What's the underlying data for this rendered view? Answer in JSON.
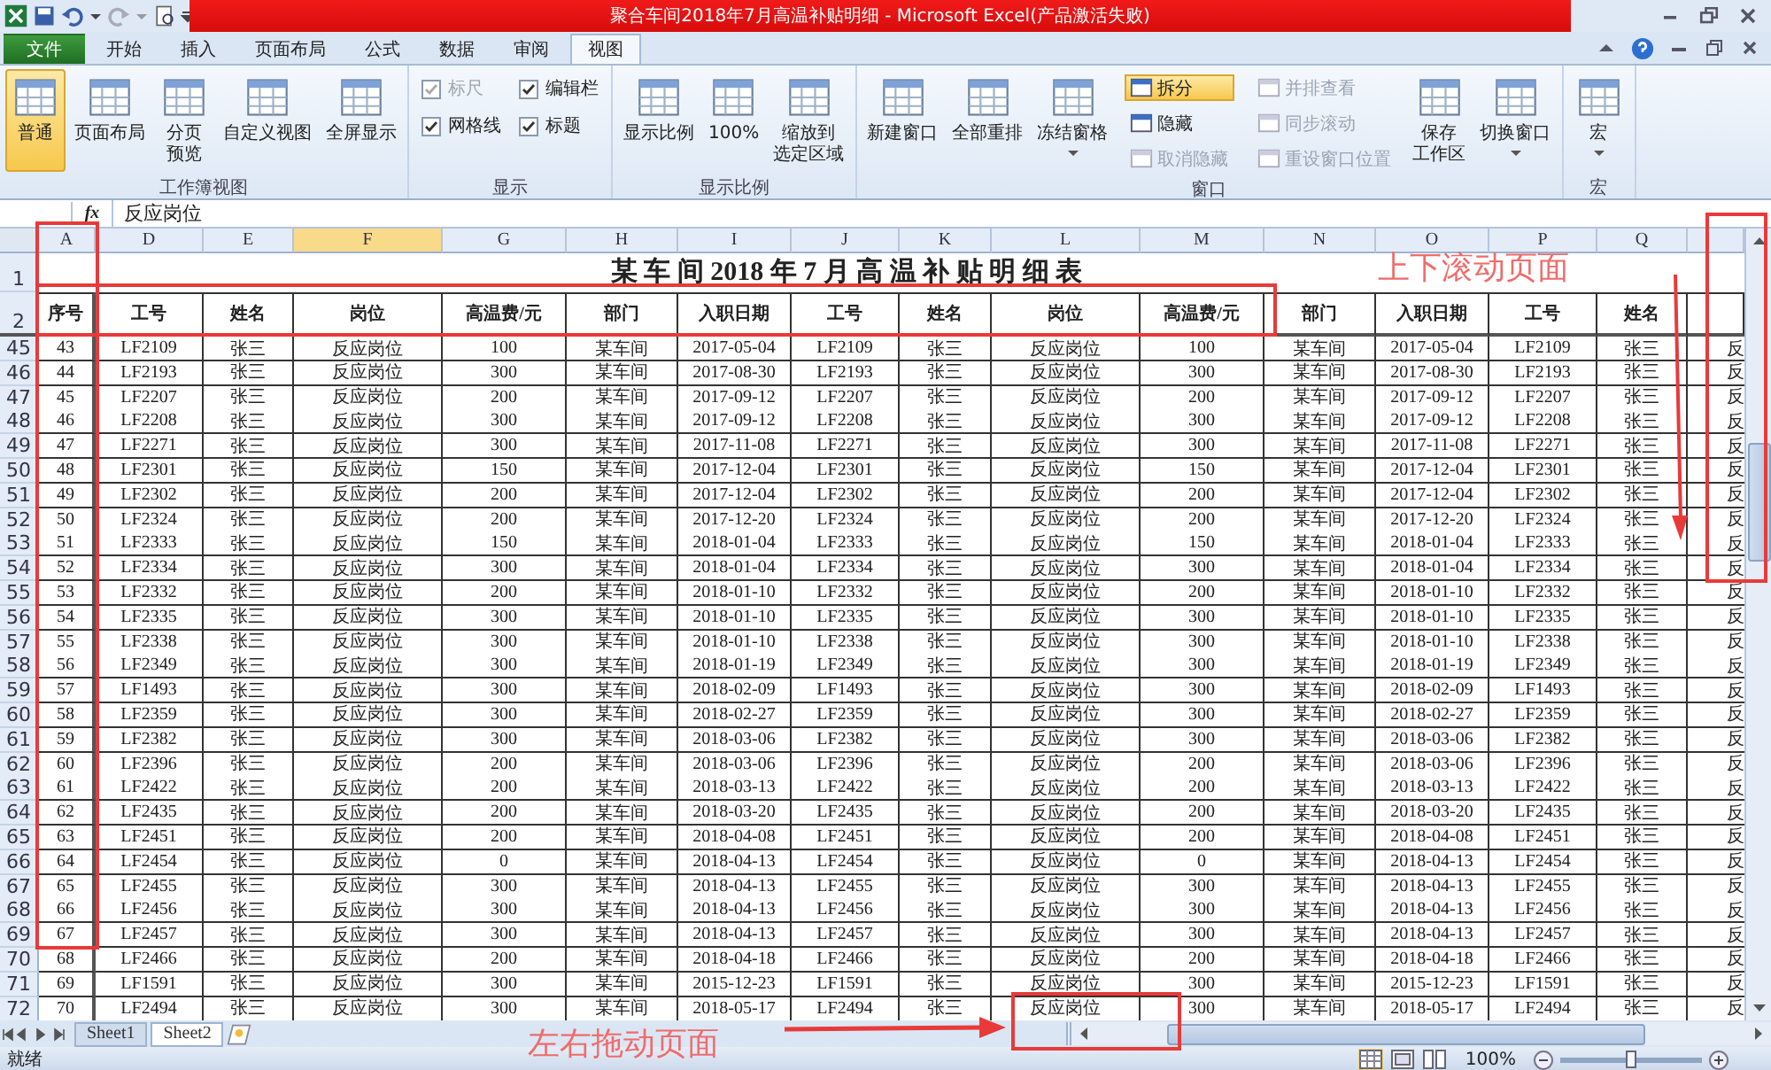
{
  "title_bar": {
    "title": "聚合车间2018年7月高温补贴明细 - Microsoft Excel(产品激活失败)"
  },
  "tabs": [
    {
      "label": "文件",
      "kind": "file",
      "selected": false
    },
    {
      "label": "开始",
      "kind": "tab",
      "selected": false
    },
    {
      "label": "插入",
      "kind": "tab",
      "selected": false
    },
    {
      "label": "页面布局",
      "kind": "tab",
      "selected": false
    },
    {
      "label": "公式",
      "kind": "tab",
      "selected": false
    },
    {
      "label": "数据",
      "kind": "tab",
      "selected": false
    },
    {
      "label": "审阅",
      "kind": "tab",
      "selected": false
    },
    {
      "label": "视图",
      "kind": "tab",
      "selected": true
    }
  ],
  "ribbon": [
    {
      "label": "工作簿视图",
      "items": [
        {
          "kind": "large",
          "label": "普通",
          "selected": true,
          "dropdown": false
        },
        {
          "kind": "large",
          "label": "页面布局",
          "selected": false,
          "dropdown": false
        },
        {
          "kind": "large",
          "lines": [
            "分页",
            "预览"
          ],
          "selected": false,
          "dropdown": false
        },
        {
          "kind": "large",
          "label": "自定义视图",
          "selected": false,
          "dropdown": false
        },
        {
          "kind": "large",
          "label": "全屏显示",
          "selected": false,
          "dropdown": false
        }
      ]
    },
    {
      "label": "显示",
      "items": [
        {
          "kind": "stack",
          "items": [
            {
              "kind": "check",
              "label": "标尺",
              "checked": true,
              "disabled": true
            },
            {
              "kind": "check",
              "label": "网格线",
              "checked": true,
              "disabled": false
            }
          ]
        },
        {
          "kind": "stack",
          "items": [
            {
              "kind": "check",
              "label": "编辑栏",
              "checked": true,
              "disabled": false
            },
            {
              "kind": "check",
              "label": "标题",
              "checked": true,
              "disabled": false
            }
          ]
        }
      ]
    },
    {
      "label": "显示比例",
      "items": [
        {
          "kind": "large",
          "label": "显示比例",
          "selected": false,
          "dropdown": false
        },
        {
          "kind": "large",
          "label": "100%",
          "selected": false,
          "dropdown": false
        },
        {
          "kind": "large",
          "lines": [
            "缩放到",
            "选定区域"
          ],
          "selected": false,
          "dropdown": false
        }
      ]
    },
    {
      "label": "窗口",
      "items": [
        {
          "kind": "large",
          "label": "新建窗口",
          "selected": false,
          "dropdown": false
        },
        {
          "kind": "large",
          "label": "全部重排",
          "selected": false,
          "dropdown": false
        },
        {
          "kind": "large",
          "label": "冻结窗格",
          "selected": false,
          "dropdown": true
        },
        {
          "kind": "stack",
          "items": [
            {
              "kind": "small",
              "label": "拆分",
              "selected": true,
              "disabled": false
            },
            {
              "kind": "small",
              "label": "隐藏",
              "selected": false,
              "disabled": false
            },
            {
              "kind": "small",
              "label": "取消隐藏",
              "selected": false,
              "disabled": true
            }
          ]
        },
        {
          "kind": "stack",
          "items": [
            {
              "kind": "small",
              "label": "并排查看",
              "selected": false,
              "disabled": true
            },
            {
              "kind": "small",
              "label": "同步滚动",
              "selected": false,
              "disabled": true
            },
            {
              "kind": "small",
              "label": "重设窗口位置",
              "selected": false,
              "disabled": true
            }
          ]
        },
        {
          "kind": "large",
          "lines": [
            "保存",
            "工作区"
          ],
          "selected": false,
          "dropdown": false
        },
        {
          "kind": "large",
          "label": "切换窗口",
          "selected": false,
          "dropdown": true
        }
      ]
    },
    {
      "label": "宏",
      "items": [
        {
          "kind": "large",
          "label": "宏",
          "selected": false,
          "dropdown": true
        }
      ]
    }
  ],
  "formula_bar": {
    "fx": "fx",
    "value": "反应岗位"
  },
  "columns": [
    {
      "label": "A",
      "selected": false
    },
    {
      "label": "D",
      "selected": false
    },
    {
      "label": "E",
      "selected": false
    },
    {
      "label": "F",
      "selected": true
    },
    {
      "label": "G",
      "selected": false
    },
    {
      "label": "H",
      "selected": false
    },
    {
      "label": "I",
      "selected": false
    },
    {
      "label": "J",
      "selected": false
    },
    {
      "label": "K",
      "selected": false
    },
    {
      "label": "L",
      "selected": false
    },
    {
      "label": "M",
      "selected": false
    },
    {
      "label": "N",
      "selected": false
    },
    {
      "label": "O",
      "selected": false
    },
    {
      "label": "P",
      "selected": false
    },
    {
      "label": "Q",
      "selected": false
    }
  ],
  "title_row": {
    "row": "1",
    "title": "某 车 间 2018 年 7 月 高 温 补 贴 明 细 表"
  },
  "header_row": {
    "row": "2",
    "cells": [
      "序号",
      "工号",
      "姓名",
      "岗位",
      "高温费/元",
      "部门",
      "入职日期",
      "工号",
      "姓名",
      "岗位",
      "高温费/元",
      "部门",
      "入职日期",
      "工号",
      "姓名"
    ]
  },
  "rows": [
    {
      "row": "45",
      "cells": [
        "43",
        "LF2109",
        "张三",
        "反应岗位",
        "100",
        "某车间",
        "2017-05-04",
        "LF2109",
        "张三",
        "反应岗位",
        "100",
        "某车间",
        "2017-05-04",
        "LF2109",
        "张三",
        "反"
      ]
    },
    {
      "row": "46",
      "cells": [
        "44",
        "LF2193",
        "张三",
        "反应岗位",
        "300",
        "某车间",
        "2017-08-30",
        "LF2193",
        "张三",
        "反应岗位",
        "300",
        "某车间",
        "2017-08-30",
        "LF2193",
        "张三",
        "反"
      ]
    },
    {
      "row": "47",
      "cells": [
        "45",
        "LF2207",
        "张三",
        "反应岗位",
        "200",
        "某车间",
        "2017-09-12",
        "LF2207",
        "张三",
        "反应岗位",
        "200",
        "某车间",
        "2017-09-12",
        "LF2207",
        "张三",
        "反"
      ]
    },
    {
      "row": "48",
      "cells": [
        "46",
        "LF2208",
        "张三",
        "反应岗位",
        "300",
        "某车间",
        "2017-09-12",
        "LF2208",
        "张三",
        "反应岗位",
        "300",
        "某车间",
        "2017-09-12",
        "LF2208",
        "张三",
        "反"
      ]
    },
    {
      "row": "49",
      "cells": [
        "47",
        "LF2271",
        "张三",
        "反应岗位",
        "300",
        "某车间",
        "2017-11-08",
        "LF2271",
        "张三",
        "反应岗位",
        "300",
        "某车间",
        "2017-11-08",
        "LF2271",
        "张三",
        "反"
      ]
    },
    {
      "row": "50",
      "cells": [
        "48",
        "LF2301",
        "张三",
        "反应岗位",
        "150",
        "某车间",
        "2017-12-04",
        "LF2301",
        "张三",
        "反应岗位",
        "150",
        "某车间",
        "2017-12-04",
        "LF2301",
        "张三",
        "反"
      ]
    },
    {
      "row": "51",
      "cells": [
        "49",
        "LF2302",
        "张三",
        "反应岗位",
        "200",
        "某车间",
        "2017-12-04",
        "LF2302",
        "张三",
        "反应岗位",
        "200",
        "某车间",
        "2017-12-04",
        "LF2302",
        "张三",
        "反"
      ]
    },
    {
      "row": "52",
      "cells": [
        "50",
        "LF2324",
        "张三",
        "反应岗位",
        "200",
        "某车间",
        "2017-12-20",
        "LF2324",
        "张三",
        "反应岗位",
        "200",
        "某车间",
        "2017-12-20",
        "LF2324",
        "张三",
        "反"
      ]
    },
    {
      "row": "53",
      "cells": [
        "51",
        "LF2333",
        "张三",
        "反应岗位",
        "150",
        "某车间",
        "2018-01-04",
        "LF2333",
        "张三",
        "反应岗位",
        "150",
        "某车间",
        "2018-01-04",
        "LF2333",
        "张三",
        "反"
      ]
    },
    {
      "row": "54",
      "cells": [
        "52",
        "LF2334",
        "张三",
        "反应岗位",
        "300",
        "某车间",
        "2018-01-04",
        "LF2334",
        "张三",
        "反应岗位",
        "300",
        "某车间",
        "2018-01-04",
        "LF2334",
        "张三",
        "反"
      ]
    },
    {
      "row": "55",
      "cells": [
        "53",
        "LF2332",
        "张三",
        "反应岗位",
        "200",
        "某车间",
        "2018-01-10",
        "LF2332",
        "张三",
        "反应岗位",
        "200",
        "某车间",
        "2018-01-10",
        "LF2332",
        "张三",
        "反"
      ]
    },
    {
      "row": "56",
      "cells": [
        "54",
        "LF2335",
        "张三",
        "反应岗位",
        "300",
        "某车间",
        "2018-01-10",
        "LF2335",
        "张三",
        "反应岗位",
        "300",
        "某车间",
        "2018-01-10",
        "LF2335",
        "张三",
        "反"
      ]
    },
    {
      "row": "57",
      "cells": [
        "55",
        "LF2338",
        "张三",
        "反应岗位",
        "300",
        "某车间",
        "2018-01-10",
        "LF2338",
        "张三",
        "反应岗位",
        "300",
        "某车间",
        "2018-01-10",
        "LF2338",
        "张三",
        "反"
      ]
    },
    {
      "row": "58",
      "cells": [
        "56",
        "LF2349",
        "张三",
        "反应岗位",
        "300",
        "某车间",
        "2018-01-19",
        "LF2349",
        "张三",
        "反应岗位",
        "300",
        "某车间",
        "2018-01-19",
        "LF2349",
        "张三",
        "反"
      ]
    },
    {
      "row": "59",
      "cells": [
        "57",
        "LF1493",
        "张三",
        "反应岗位",
        "300",
        "某车间",
        "2018-02-09",
        "LF1493",
        "张三",
        "反应岗位",
        "300",
        "某车间",
        "2018-02-09",
        "LF1493",
        "张三",
        "反"
      ]
    },
    {
      "row": "60",
      "cells": [
        "58",
        "LF2359",
        "张三",
        "反应岗位",
        "300",
        "某车间",
        "2018-02-27",
        "LF2359",
        "张三",
        "反应岗位",
        "300",
        "某车间",
        "2018-02-27",
        "LF2359",
        "张三",
        "反"
      ]
    },
    {
      "row": "61",
      "cells": [
        "59",
        "LF2382",
        "张三",
        "反应岗位",
        "300",
        "某车间",
        "2018-03-06",
        "LF2382",
        "张三",
        "反应岗位",
        "300",
        "某车间",
        "2018-03-06",
        "LF2382",
        "张三",
        "反"
      ]
    },
    {
      "row": "62",
      "cells": [
        "60",
        "LF2396",
        "张三",
        "反应岗位",
        "200",
        "某车间",
        "2018-03-06",
        "LF2396",
        "张三",
        "反应岗位",
        "200",
        "某车间",
        "2018-03-06",
        "LF2396",
        "张三",
        "反"
      ]
    },
    {
      "row": "63",
      "cells": [
        "61",
        "LF2422",
        "张三",
        "反应岗位",
        "200",
        "某车间",
        "2018-03-13",
        "LF2422",
        "张三",
        "反应岗位",
        "200",
        "某车间",
        "2018-03-13",
        "LF2422",
        "张三",
        "反"
      ]
    },
    {
      "row": "64",
      "cells": [
        "62",
        "LF2435",
        "张三",
        "反应岗位",
        "200",
        "某车间",
        "2018-03-20",
        "LF2435",
        "张三",
        "反应岗位",
        "200",
        "某车间",
        "2018-03-20",
        "LF2435",
        "张三",
        "反"
      ]
    },
    {
      "row": "65",
      "cells": [
        "63",
        "LF2451",
        "张三",
        "反应岗位",
        "200",
        "某车间",
        "2018-04-08",
        "LF2451",
        "张三",
        "反应岗位",
        "200",
        "某车间",
        "2018-04-08",
        "LF2451",
        "张三",
        "反"
      ]
    },
    {
      "row": "66",
      "cells": [
        "64",
        "LF2454",
        "张三",
        "反应岗位",
        "0",
        "某车间",
        "2018-04-13",
        "LF2454",
        "张三",
        "反应岗位",
        "0",
        "某车间",
        "2018-04-13",
        "LF2454",
        "张三",
        "反"
      ]
    },
    {
      "row": "67",
      "cells": [
        "65",
        "LF2455",
        "张三",
        "反应岗位",
        "300",
        "某车间",
        "2018-04-13",
        "LF2455",
        "张三",
        "反应岗位",
        "300",
        "某车间",
        "2018-04-13",
        "LF2455",
        "张三",
        "反"
      ]
    },
    {
      "row": "68",
      "cells": [
        "66",
        "LF2456",
        "张三",
        "反应岗位",
        "300",
        "某车间",
        "2018-04-13",
        "LF2456",
        "张三",
        "反应岗位",
        "300",
        "某车间",
        "2018-04-13",
        "LF2456",
        "张三",
        "反"
      ]
    },
    {
      "row": "69",
      "cells": [
        "67",
        "LF2457",
        "张三",
        "反应岗位",
        "300",
        "某车间",
        "2018-04-13",
        "LF2457",
        "张三",
        "反应岗位",
        "300",
        "某车间",
        "2018-04-13",
        "LF2457",
        "张三",
        "反"
      ]
    },
    {
      "row": "70",
      "cells": [
        "68",
        "LF2466",
        "张三",
        "反应岗位",
        "200",
        "某车间",
        "2018-04-18",
        "LF2466",
        "张三",
        "反应岗位",
        "200",
        "某车间",
        "2018-04-18",
        "LF2466",
        "张三",
        "反"
      ]
    },
    {
      "row": "71",
      "cells": [
        "69",
        "LF1591",
        "张三",
        "反应岗位",
        "300",
        "某车间",
        "2015-12-23",
        "LF1591",
        "张三",
        "反应岗位",
        "300",
        "某车间",
        "2015-12-23",
        "LF1591",
        "张三",
        "反"
      ]
    },
    {
      "row": "72",
      "cells": [
        "70",
        "LF2494",
        "张三",
        "反应岗位",
        "300",
        "某车间",
        "2018-05-17",
        "LF2494",
        "张三",
        "反应岗位",
        "300",
        "某车间",
        "2018-05-17",
        "LF2494",
        "张三",
        "反"
      ]
    }
  ],
  "sheets": [
    {
      "label": "Sheet1",
      "selected": false
    },
    {
      "label": "Sheet2",
      "selected": true
    }
  ],
  "status_bar": {
    "status": "就绪",
    "zoom": "100%",
    "zoom_slider": {
      "level": 0.5
    }
  },
  "annotations": [
    {
      "text": "上下滚动页面"
    },
    {
      "text": "左右拖动页面"
    }
  ]
}
